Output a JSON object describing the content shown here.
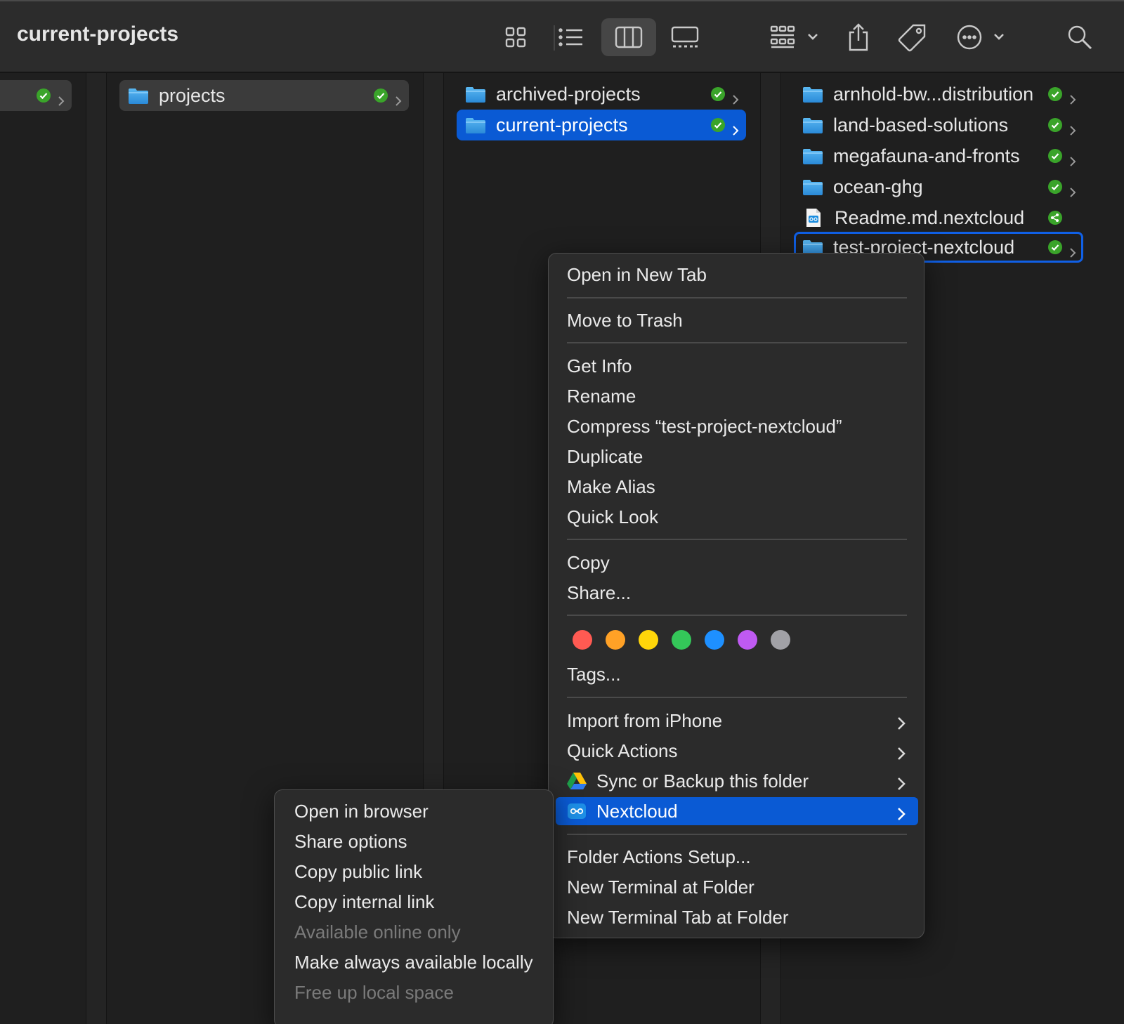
{
  "window": {
    "title": "current-projects"
  },
  "toolbar": {
    "icons": [
      "icon-view-grid-icon",
      "list-view-icon",
      "column-view-icon",
      "gallery-view-icon",
      "group-by-icon",
      "share-icon",
      "tag-icon",
      "more-actions-icon",
      "search-icon"
    ]
  },
  "columns": {
    "col1": {
      "items": [
        {
          "label": "",
          "status": "synced"
        }
      ]
    },
    "col2": {
      "items": [
        {
          "label": "projects",
          "status": "synced"
        }
      ]
    },
    "col3": {
      "items": [
        {
          "label": "archived-projects",
          "status": "synced"
        },
        {
          "label": "current-projects",
          "status": "synced",
          "selected": true
        }
      ]
    },
    "col4": {
      "items": [
        {
          "label": "arnhold-bw...distribution",
          "status": "synced"
        },
        {
          "label": "land-based-solutions",
          "status": "synced"
        },
        {
          "label": "megafauna-and-fronts",
          "status": "synced"
        },
        {
          "label": "ocean-ghg",
          "status": "synced"
        },
        {
          "label": "Readme.md.nextcloud",
          "status": "shared"
        },
        {
          "label": "test-project-nextcloud",
          "status": "synced",
          "focused": true
        }
      ]
    }
  },
  "context_menu": {
    "open_new_tab": "Open in New Tab",
    "move_to_trash": "Move to Trash",
    "get_info": "Get Info",
    "rename": "Rename",
    "compress": "Compress “test-project-nextcloud”",
    "duplicate": "Duplicate",
    "make_alias": "Make Alias",
    "quick_look": "Quick Look",
    "copy": "Copy",
    "share": "Share...",
    "tag_colors": [
      "#ff5a52",
      "#ffa126",
      "#ffd60a",
      "#34c759",
      "#1e90ff",
      "#bf5af2",
      "#a1a1a6"
    ],
    "tags": "Tags...",
    "import_iphone": "Import from iPhone",
    "quick_actions": "Quick Actions",
    "sync_backup": "Sync or Backup this folder",
    "nextcloud": "Nextcloud",
    "folder_actions": "Folder Actions Setup...",
    "new_terminal": "New Terminal at Folder",
    "new_terminal_tab": "New Terminal Tab at Folder"
  },
  "nextcloud_submenu": {
    "open_browser": "Open in browser",
    "share_options": "Share options",
    "copy_public": "Copy public link",
    "copy_internal": "Copy internal link",
    "available_online": "Available online only",
    "make_local": "Make always available locally",
    "free_up": "Free up local space"
  },
  "colors": {
    "selection": "#0a5ad4",
    "sync_ok": "#3aa42a",
    "folder": "#3aa0e6"
  }
}
